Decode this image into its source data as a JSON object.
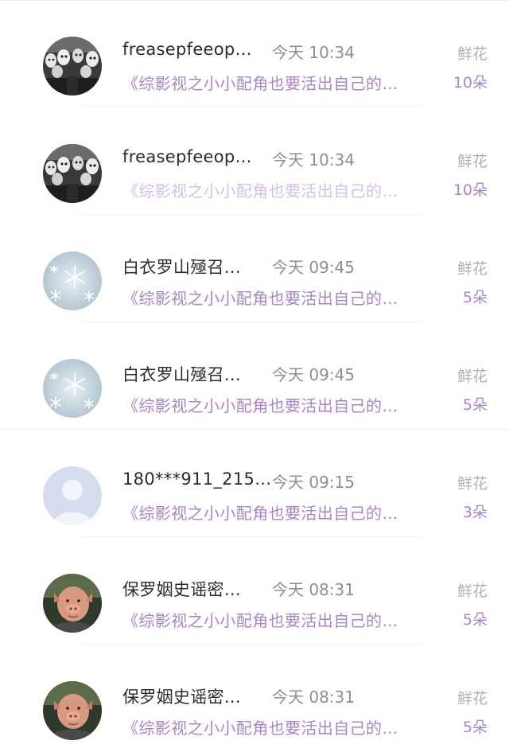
{
  "records": [
    {
      "name": "freasepfeeop…",
      "time": "今天 10:34",
      "label": "鲜花",
      "book": "《综影视之小小配角也要活出自己的…",
      "count": "10朵",
      "avatar": "masks-avatar",
      "faded": false
    },
    {
      "name": "freasepfeeop…",
      "time": "今天 10:34",
      "label": "鲜花",
      "book": "《综影视之小小配角也要活出自己的…",
      "count": "10朵",
      "avatar": "masks-avatar",
      "faded": true
    },
    {
      "name": "白衣罗山殛召…",
      "time": "今天 09:45",
      "label": "鲜花",
      "book": "《综影视之小小配角也要活出自己的…",
      "count": "5朵",
      "avatar": "snowflake-avatar",
      "faded": false
    },
    {
      "name": "白衣罗山殛召…",
      "time": "今天 09:45",
      "label": "鲜花",
      "book": "《综影视之小小配角也要活出自己的…",
      "count": "5朵",
      "avatar": "snowflake-avatar",
      "faded": false
    },
    {
      "name": "180***911_215…",
      "time": "今天 09:15",
      "label": "鲜花",
      "book": "《综影视之小小配角也要活出自己的…",
      "count": "3朵",
      "avatar": "default-user-avatar",
      "faded": false
    },
    {
      "name": "保罗姻史谣密…",
      "time": "今天 08:31",
      "label": "鲜花",
      "book": "《综影视之小小配角也要活出自己的…",
      "count": "5朵",
      "avatar": "pig-man-avatar",
      "faded": false
    },
    {
      "name": "保罗姻史谣密…",
      "time": "今天 08:31",
      "label": "鲜花",
      "book": "《综影视之小小配角也要活出自己的…",
      "count": "5朵",
      "avatar": "pig-man-avatar",
      "faded": false
    }
  ],
  "colors": {
    "book_title": "#a884c9",
    "book_title_faded": "#d3c0e6",
    "name": "#2b2b2b",
    "time": "#8f8f8f",
    "label": "#b0b0b0"
  }
}
